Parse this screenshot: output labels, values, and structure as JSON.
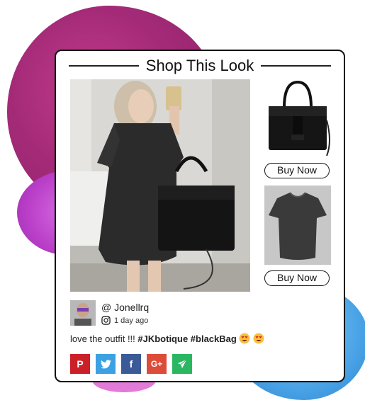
{
  "header": {
    "title": "Shop This Look"
  },
  "products": [
    {
      "name": "black-handbag",
      "button_label": "Buy Now"
    },
    {
      "name": "grey-tshirt",
      "button_label": "Buy Now"
    }
  ],
  "post": {
    "username": "@ Jonellrq",
    "time": "1 day ago",
    "caption_text": "love the outfit !!! ",
    "hashtags": "#JKbotique #blackBag",
    "emoji_icon": "heart-eyes-emoji"
  },
  "share": {
    "pinterest": {
      "label": "P",
      "color": "#cb2027"
    },
    "twitter": {
      "label": "t",
      "color": "#3ba1e3"
    },
    "facebook": {
      "label": "f",
      "color": "#3a5a98"
    },
    "googleplus": {
      "label": "G+",
      "color": "#dd4b39"
    },
    "send": {
      "label": "➤",
      "color": "#2bb761"
    }
  },
  "colors": {
    "blob_magenta": "#a42a78",
    "blob_violet": "#b93ec8",
    "blob_blue": "#4aa3e6",
    "card_border": "#111111"
  }
}
